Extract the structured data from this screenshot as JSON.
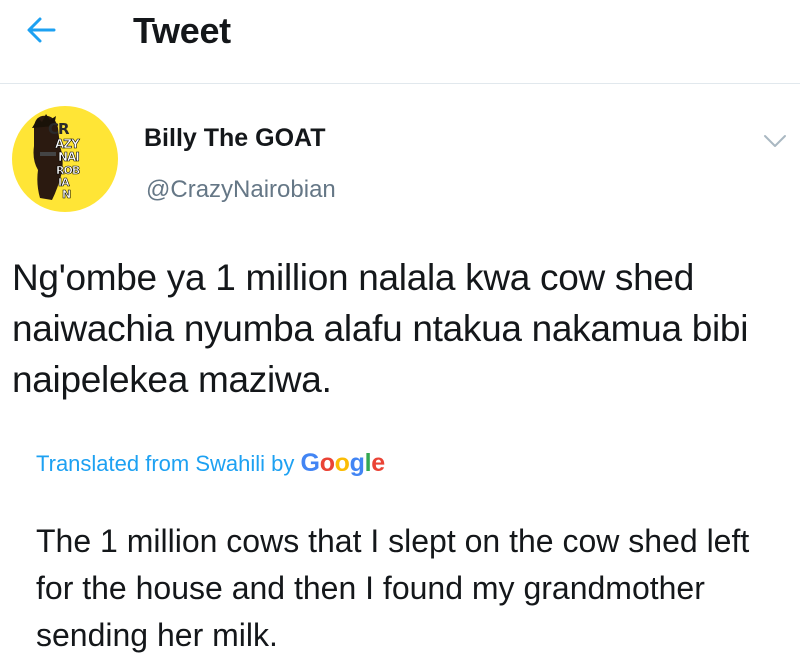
{
  "header": {
    "title": "Tweet",
    "back_icon": "arrow-left-icon",
    "accent_color": "#1da1f2"
  },
  "author": {
    "display_name": "Billy The GOAT",
    "handle": "@CrazyNairobian",
    "avatar_background": "#ffe536",
    "avatar_text": [
      "CR",
      "AZY",
      "NAI",
      "ROB",
      "IA",
      "N"
    ]
  },
  "tweet": {
    "text": "Ng'ombe ya 1 million nalala kwa cow shed naiwachia nyumba alafu ntakua nakamua bibi naipelekea maziwa.",
    "menu_icon": "chevron-down-icon"
  },
  "translation": {
    "label": "Translated from Swahili by",
    "provider": [
      "G",
      "o",
      "o",
      "g",
      "l",
      "e"
    ],
    "provider_colors": [
      "#4285F4",
      "#EA4335",
      "#FBBC05",
      "#4285F4",
      "#34A853",
      "#EA4335"
    ],
    "text": "The 1 million cows that I slept on the cow shed left for the house and then I found my grandmother sending her milk."
  }
}
